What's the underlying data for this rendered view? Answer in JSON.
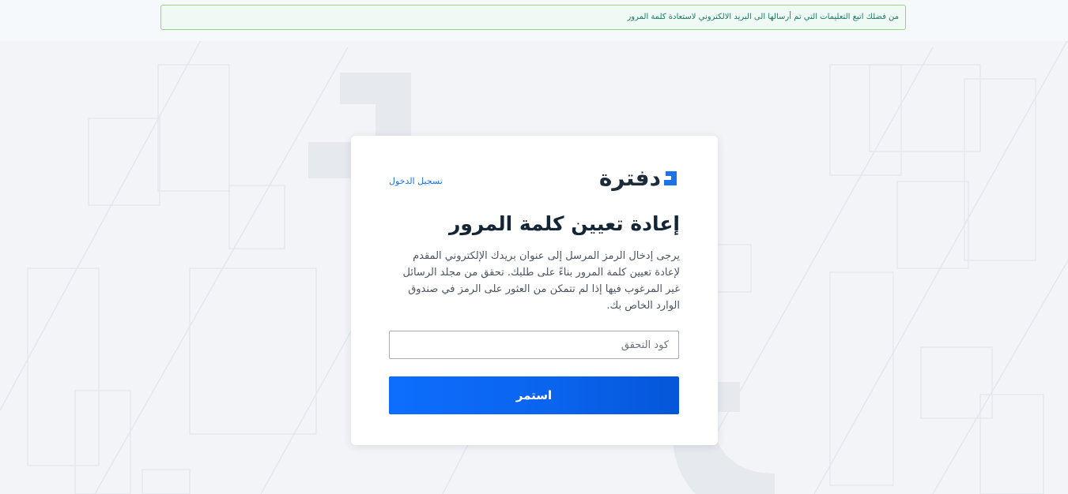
{
  "alert": {
    "message": "من فضلك اتبع التعليمات التي تم أرسالها الى البريد الالكتروني لاستعادة كلمة المرور"
  },
  "header": {
    "logo_text": "دفترة",
    "login_link": "تسجيل الدخول"
  },
  "form": {
    "title": "إعادة تعيين كلمة المرور",
    "description": "يرجى إدخال الرمز المرسل إلى عنوان بريدك الإلكتروني المقدم لإعادة تعيين كلمة المرور بناءً على طلبك. تحقق من مجلد الرسائل غير المرغوب فيها إذا لم تتمكن من العثور على الرمز في صندوق الوارد الخاص بك.",
    "code_placeholder": "كود التحقق",
    "code_value": "",
    "submit_label": "استمر"
  },
  "colors": {
    "accent": "#0d6efd",
    "alert_border": "#9fd27f",
    "alert_bg": "#effaf4",
    "alert_text": "#1b7a68",
    "title": "#142536",
    "logo_mark": "#1a73e8"
  }
}
